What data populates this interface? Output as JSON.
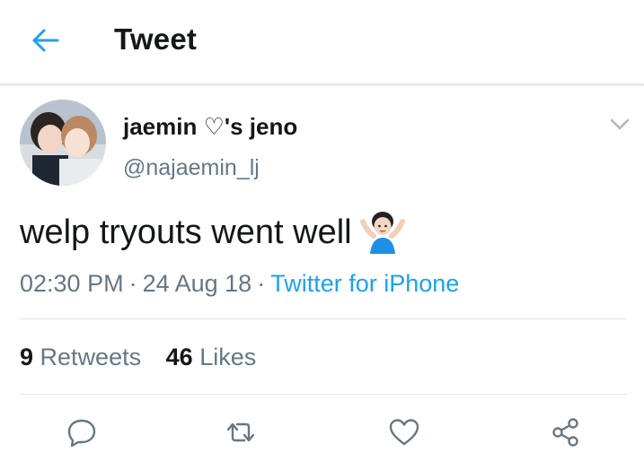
{
  "header": {
    "title": "Tweet",
    "back_icon": "arrow-left-icon",
    "accent_color": "#1da1f2"
  },
  "tweet": {
    "display_name": "jaemin ♡'s jeno",
    "handle": "@najaemin_lj",
    "text": "welp tryouts went well",
    "emoji": "person-shrugging-emoji",
    "time": "02:30 PM",
    "date": "24 Aug 18",
    "separator": "·",
    "source": "Twitter for iPhone",
    "retweets_count": "9",
    "retweets_label": "Retweets",
    "likes_count": "46",
    "likes_label": "Likes"
  },
  "actions": [
    "reply-icon",
    "retweet-icon",
    "like-icon",
    "share-icon"
  ]
}
